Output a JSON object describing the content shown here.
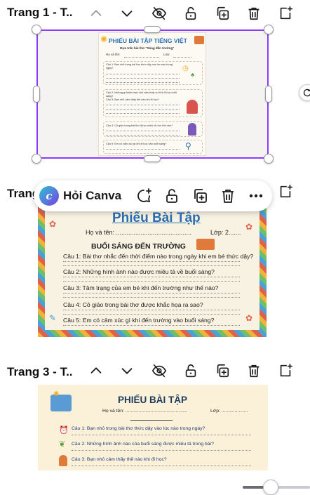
{
  "colors": {
    "accent": "#8b3dff",
    "icon": "#1b1b1f",
    "muted": "#7a7a7a",
    "sheet_blue": "#2a6fb3"
  },
  "page1": {
    "title": "Trang 1 - T..",
    "sheet": {
      "title": "PHIẾU BÀI TẬP TIẾNG VIỆT",
      "subtitle": "Dựa trên bài thơ \"Sáng đến trường\"",
      "name_label": "Họ và tên:",
      "class_label": "Lớp:",
      "questions": [
        "Câu 1: Bạn nhỏ trong bài thơ thức dậy vào lúc nào trong ngày?",
        "Câu 2: Những gì khiến bạn nhỏ cảm thấy vui khi đi học buổi sáng?",
        "Câu 3: Bạn nhỏ cảm thấy thế nào khi đi học?",
        "Câu 4: Cô giáo trong bài thơ được miêu tả như thế nào?",
        "Câu 5: Em có cảm xúc gì khi đi học vào buổi sáng?"
      ]
    }
  },
  "page2": {
    "title": "Trang",
    "sheet": {
      "title": "Phiếu Bài Tập",
      "name_label": "Họ và tên: ...........................................",
      "class_label": "Lớp: 2.......",
      "heading": "BUỔI SÁNG ĐẾN TRƯỜNG",
      "questions": [
        "Câu 1: Bài thơ nhắc đến thời điểm nào trong ngày khi em bé thức dậy?",
        "Câu 2: Những hình ảnh nào được miêu tả về buổi sáng?",
        "Câu 3: Tâm trạng của em bé khi đến trường như thế nào?",
        "Câu 4: Cô giáo trong bài thơ được khắc họa ra sao?",
        "Câu 5: Em có cảm xúc gì khi đến trường vào buổi sáng?"
      ]
    }
  },
  "toolbar": {
    "ask_canva_label": "Hỏi Canva"
  },
  "page3": {
    "title": "Trang 3 - T..",
    "sheet": {
      "title": "PHIẾU BÀI TẬP",
      "name_label": "Họ và tên: ...............................................",
      "class_label": "Lớp: ....................",
      "questions": [
        "Câu 1: Bạn nhỏ trong bài thơ thức dậy vào lúc nào trong ngày?",
        "Câu 2: Những hình ảnh nào của buổi sáng được miêu tả trong bài?",
        "Câu 3: Bạn nhỏ cảm thấy thế nào khi đi học?"
      ]
    }
  },
  "zoom": {
    "level": 0.42
  }
}
